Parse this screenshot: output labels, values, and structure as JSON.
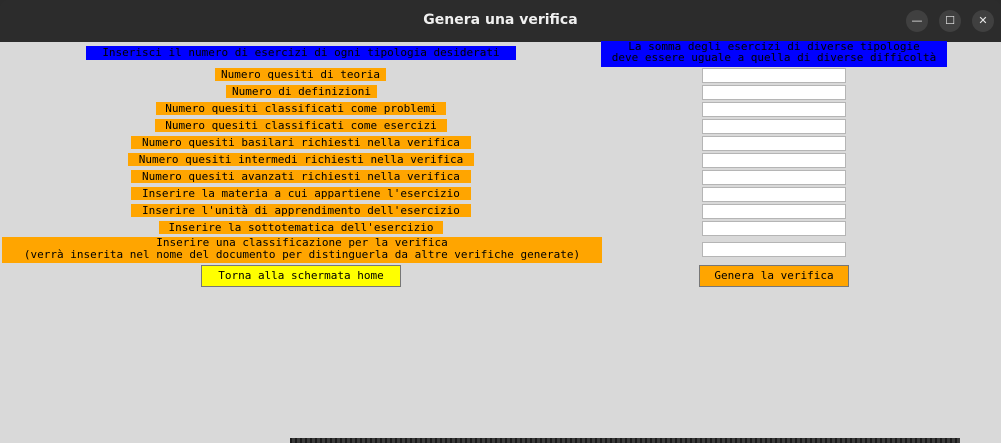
{
  "window": {
    "title": "Genera una verifica",
    "controls": {
      "minimize": "—",
      "maximize": "☐",
      "close": "✕"
    }
  },
  "form": {
    "info_left": "Inserisci il numero di esercizi di ogni tipologia desiderati",
    "info_right": "La somma degli esercizi di diverse tipologie\ndeve essere uguale a quella di diverse difficoltà",
    "labels": [
      "Numero quesiti di teoria",
      "Numero di definizioni",
      "Numero quesiti classificati come problemi",
      "Numero quesiti classificati come esercizi",
      "Numero quesiti basilari richiesti nella verifica",
      "Numero quesiti intermedi richiesti nella verifica",
      "Numero quesiti avanzati richiesti nella verifica",
      "Inserire la materia a cui appartiene l'esercizio",
      "Inserire l'unità di apprendimento dell'esercizio",
      "Inserire la sottotematica dell'esercizio",
      "Inserire una classificazione per la verifica\n(verrà inserita nel nome del documento per distinguerla da altre verifiche generate)"
    ],
    "fields": [
      "",
      "",
      "",
      "",
      "",
      "",
      "",
      "",
      "",
      "",
      ""
    ],
    "home_button": "Torna alla schermata home",
    "generate_button": "Genera la verifica"
  },
  "colors": {
    "label_bg": "#ffa500",
    "info_bg": "#0000ff",
    "home_bg": "#ffff00",
    "generate_bg": "#ffa500"
  }
}
